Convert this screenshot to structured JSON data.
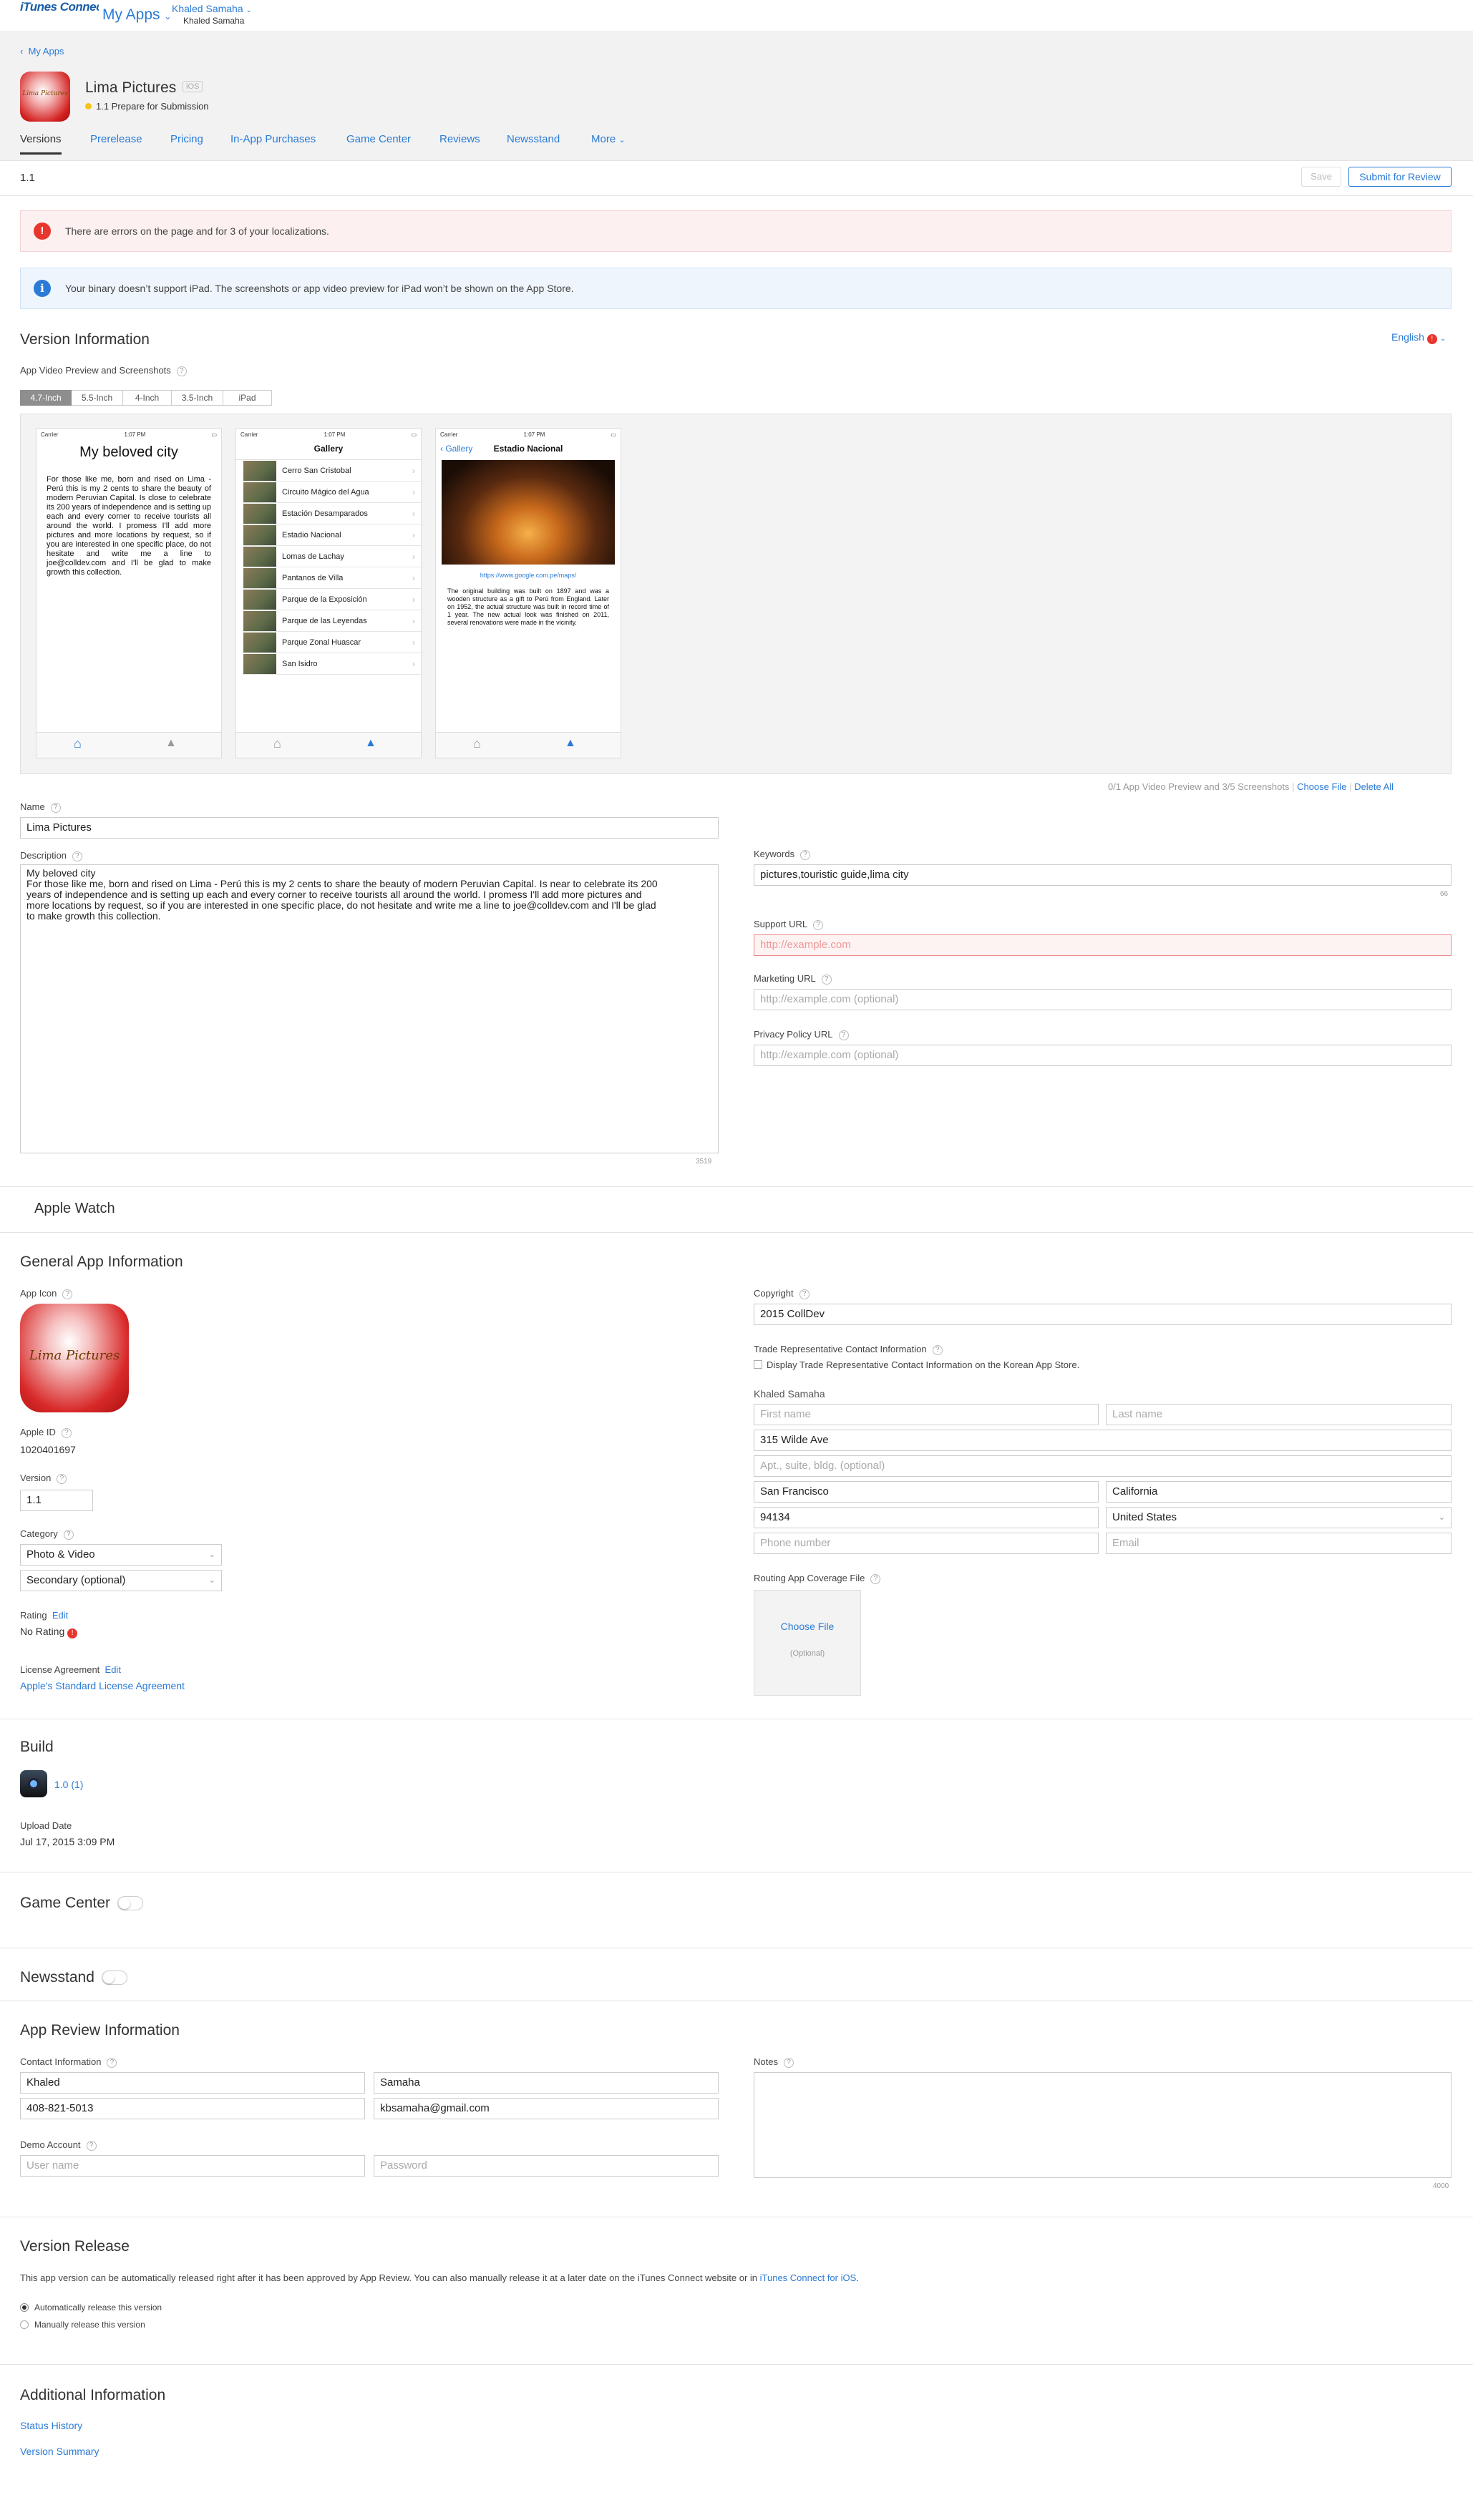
{
  "brand": "iTunes Connect",
  "header": {
    "my_apps": "My Apps",
    "user": "Khaled Samaha",
    "user_sub": "Khaled Samaha"
  },
  "breadcrumb": "My Apps",
  "app": {
    "name": "Lima Pictures",
    "platform": "iOS",
    "status": "1.1 Prepare for Submission"
  },
  "tabs": [
    "Versions",
    "Prerelease",
    "Pricing",
    "In-App Purchases",
    "Game Center",
    "Reviews",
    "Newsstand",
    "More"
  ],
  "version_bar": {
    "version": "1.1",
    "save": "Save",
    "submit": "Submit for Review"
  },
  "alerts": {
    "error": "There are errors on the page and for 3 of your localizations.",
    "info": "Your binary doesn’t support iPad. The screenshots or app video preview for iPad won’t be shown on the App Store."
  },
  "version_info": {
    "title": "Version Information",
    "language": "English",
    "screens_label": "App Video Preview and Screenshots",
    "sizes": [
      "4.7-Inch",
      "5.5-Inch",
      "4-Inch",
      "3.5-Inch",
      "iPad"
    ],
    "screens_status": "0/1 App Video Preview and 3/5 Screenshots",
    "choose_file": "Choose File",
    "delete_all": "Delete All"
  },
  "phones": {
    "carrier": "Carrier",
    "time": "1:07 PM",
    "p1": {
      "title": "My beloved city",
      "text": "For those like me, born and rised on Lima - Perú this is my 2 cents to share the beauty of modern Peruvian Capital. Is close to celebrate its 200 years of independence and is setting up each and every corner to receive tourists all around the world. I promess I'll add more pictures and more locations by request, so if you are interested in one specific place, do not hesitate and write me a line to joe@colldev.com and I'll be glad to make growth this collection."
    },
    "p2": {
      "title": "Gallery",
      "items": [
        "Cerro San Cristobal",
        "Circuito Mágico del Agua",
        "Estación Desamparados",
        "Estadio Nacional",
        "Lomas de Lachay",
        "Pantanos de Villa",
        "Parque de la Exposición",
        "Parque de las Leyendas",
        "Parque Zonal Huascar",
        "San Isidro"
      ]
    },
    "p3": {
      "back": "Gallery",
      "title": "Estadio Nacional",
      "url": "https://www.google.com.pe/maps/",
      "text": "The original building was built on 1897 and was a wooden structure as a gift to Perú from England. Later on 1952, the actual structure was built in record time of 1 year. The new actual look was finished on 2011, several renovations were made in the vicinity."
    },
    "tab_home": "Home",
    "tab_gallery": "Gallery"
  },
  "fields": {
    "name_label": "Name",
    "name": "Lima Pictures",
    "desc_label": "Description",
    "desc_lines": [
      "My beloved city",
      "For those like me, born and rised on Lima - Perú this is my 2 cents to share the beauty of modern Peruvian Capital. Is near to celebrate its 200",
      "years of independence and is setting up each and every corner to receive tourists all around the world. I promess I'll add more pictures and",
      "more locations by request, so if you are interested in one specific place, do not hesitate and write me a line to joe@colldev.com and I'll be glad",
      "to make growth this collection."
    ],
    "desc_count": "3519",
    "keywords_label": "Keywords",
    "keywords": "pictures,touristic guide,lima city",
    "keywords_count": "66",
    "support_label": "Support URL",
    "support_ph": "http://example.com",
    "marketing_label": "Marketing URL",
    "marketing_ph": "http://example.com (optional)",
    "privacy_label": "Privacy Policy URL",
    "privacy_ph": "http://example.com (optional)"
  },
  "apple_watch": "Apple Watch",
  "general": {
    "title": "General App Information",
    "icon_label": "App Icon",
    "icon_text": "Lima Pictures",
    "apple_id_label": "Apple ID",
    "apple_id": "1020401697",
    "version_label": "Version",
    "version": "1.1",
    "category_label": "Category",
    "category": "Photo & Video",
    "secondary": "Secondary (optional)",
    "rating_label": "Rating",
    "rating_edit": "Edit",
    "rating": "No Rating",
    "license_label": "License Agreement",
    "license_edit": "Edit",
    "license": "Apple's Standard License Agreement",
    "copyright_label": "Copyright",
    "copyright": "2015 CollDev",
    "trade_label": "Trade Representative Contact Information",
    "trade_check": "Display Trade Representative Contact Information on the Korean App Store.",
    "contact_name": "Khaled Samaha",
    "first_ph": "First name",
    "last_ph": "Last name",
    "address1": "315 Wilde Ave",
    "address2_ph": "Apt., suite, bldg. (optional)",
    "city": "San Francisco",
    "state": "California",
    "zip": "94134",
    "country": "United States",
    "phone_ph": "Phone number",
    "email_ph": "Email",
    "routing_label": "Routing App Coverage File",
    "routing_choose": "Choose File",
    "routing_optional": "(Optional)"
  },
  "build": {
    "title": "Build",
    "version": "1.0 (1)",
    "upload_label": "Upload Date",
    "upload": "Jul 17, 2015 3:09 PM"
  },
  "game_center": "Game Center",
  "newsstand": "Newsstand",
  "review": {
    "title": "App Review Information",
    "contact_label": "Contact Information",
    "first": "Khaled",
    "last": "Samaha",
    "phone": "408-821-5013",
    "email": "kbsamaha@gmail.com",
    "demo_label": "Demo Account",
    "user_ph": "User name",
    "pass_ph": "Password",
    "notes_label": "Notes",
    "notes_count": "4000"
  },
  "release": {
    "title": "Version Release",
    "text": "This app version can be automatically released right after it has been approved by App Review. You can also manually release it at a later date on the iTunes Connect website or in ",
    "link": "iTunes Connect for iOS",
    "opt_auto": "Automatically release this version",
    "opt_manual": "Manually release this version"
  },
  "additional": {
    "title": "Additional Information",
    "status": "Status History",
    "summary": "Version Summary"
  }
}
